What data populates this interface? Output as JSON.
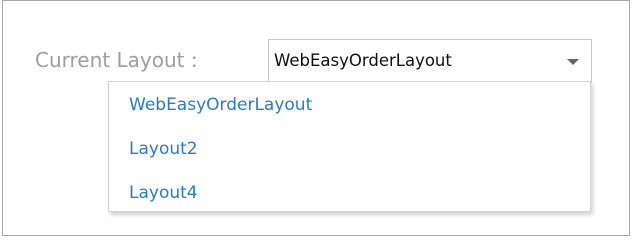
{
  "form": {
    "label": "Current Layout :",
    "select": {
      "value": "WebEasyOrderLayout",
      "icon": "chevron-down-icon"
    },
    "options": [
      {
        "label": "WebEasyOrderLayout"
      },
      {
        "label": "Layout2"
      },
      {
        "label": "Layout4"
      }
    ]
  },
  "colors": {
    "label_text": "#9e9e9e",
    "option_link": "#2a7ad1",
    "select_border": "#c9c9c9",
    "frame_border": "#a9a9a9"
  }
}
